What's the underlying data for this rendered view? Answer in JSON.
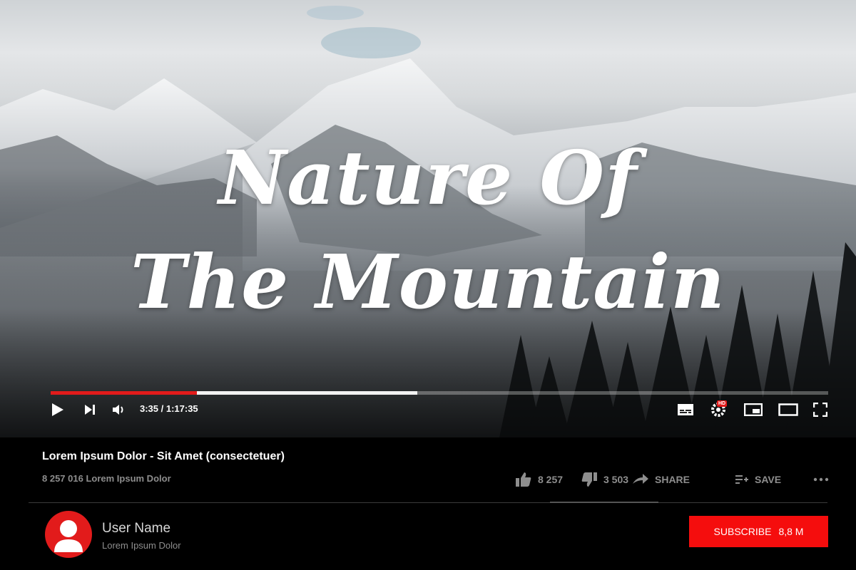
{
  "player": {
    "title_line1": "Nature Of",
    "title_line2": "The Mountain",
    "played_fraction": 0.188,
    "buffered_fraction": 0.472,
    "time_display": "3:35 / 1:17:35",
    "hd_badge": "HD",
    "controls": [
      "play-icon",
      "next-icon",
      "volume-icon",
      "subtitles-icon",
      "settings-icon",
      "miniplayer-icon",
      "theater-icon",
      "fullscreen-icon"
    ]
  },
  "video": {
    "name": "Lorem Ipsum Dolor - Sit Amet (consectetuer)",
    "views": "8 257 016 Lorem Ipsum Dolor"
  },
  "actions": {
    "likes": "8 257",
    "dislikes": "3 503",
    "share_label": "SHARE",
    "save_label": "SAVE"
  },
  "channel": {
    "user_name": "User Name",
    "subtitle": "Lorem Ipsum Dolor",
    "subscribe_label": "SUBSCRIBE",
    "subscriber_count": "8,8 M"
  },
  "colors": {
    "accent": "#e21b1b",
    "subscribe_bg": "#f50d0d",
    "muted_text": "#8e8e8e",
    "background": "#000000"
  }
}
